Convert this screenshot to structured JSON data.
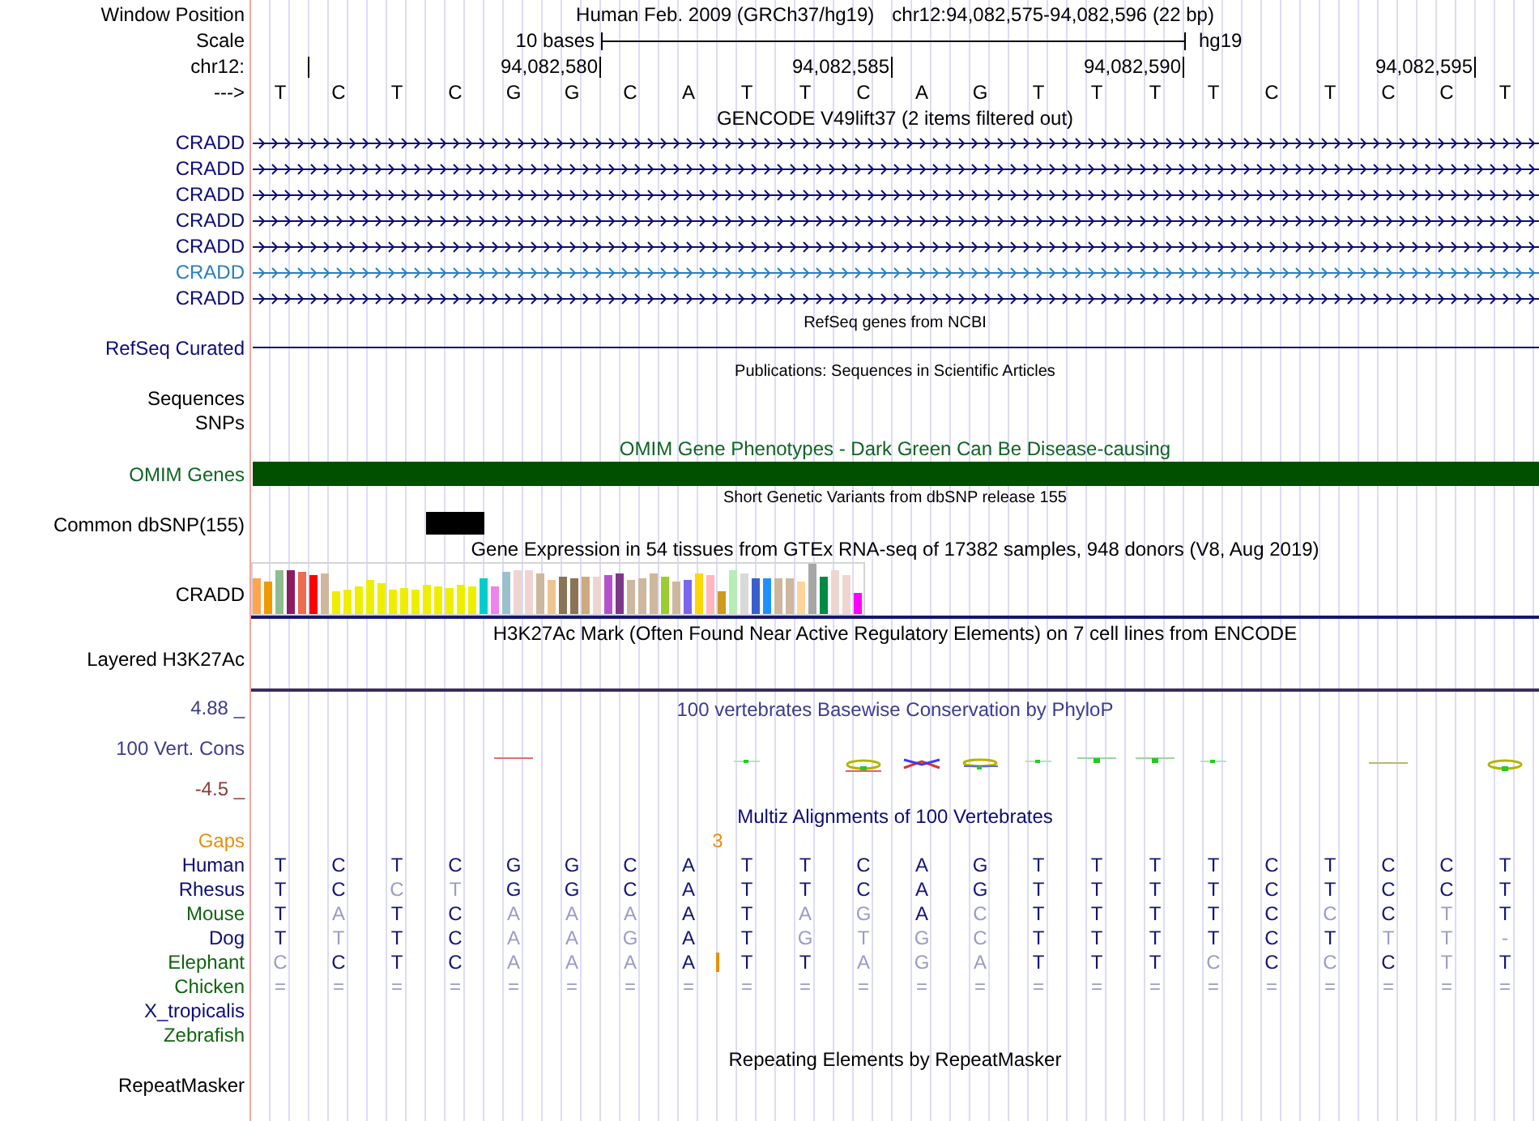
{
  "position": {
    "label": "Window Position",
    "assembly": "Human Feb. 2009 (GRCh37/hg19)",
    "range": "chr12:94,082,575-94,082,596 (22 bp)"
  },
  "scale": {
    "label": "Scale",
    "length": "10 bases",
    "assembly": "hg19"
  },
  "ruler": {
    "label": "chr12:",
    "ticks": [
      "94,082,580",
      "94,082,585",
      "94,082,590",
      "94,082,595"
    ]
  },
  "sequence": {
    "label": "--->",
    "bases": [
      {
        "base": "T",
        "common_snp": false
      },
      {
        "base": "C",
        "common_snp": false
      },
      {
        "base": "T",
        "common_snp": false
      },
      {
        "base": "C",
        "common_snp": true
      },
      {
        "base": "G",
        "common_snp": false
      },
      {
        "base": "G",
        "common_snp": false
      },
      {
        "base": "C",
        "common_snp": false
      },
      {
        "base": "A",
        "common_snp": false
      },
      {
        "base": "T",
        "common_snp": false
      },
      {
        "base": "T",
        "common_snp": false
      },
      {
        "base": "C",
        "common_snp": false
      },
      {
        "base": "A",
        "common_snp": false
      },
      {
        "base": "G",
        "common_snp": false
      },
      {
        "base": "T",
        "common_snp": false
      },
      {
        "base": "T",
        "common_snp": false
      },
      {
        "base": "T",
        "common_snp": false
      },
      {
        "base": "T",
        "common_snp": false
      },
      {
        "base": "C",
        "common_snp": false
      },
      {
        "base": "T",
        "common_snp": false
      },
      {
        "base": "C",
        "common_snp": false
      },
      {
        "base": "C",
        "common_snp": false
      },
      {
        "base": "T",
        "common_snp": false
      }
    ]
  },
  "gencode": {
    "title": "GENCODE V49lift37 (2 items filtered out)",
    "transcripts": [
      {
        "name": "CRADD",
        "color": "#0c0c78"
      },
      {
        "name": "CRADD",
        "color": "#0c0c78"
      },
      {
        "name": "CRADD",
        "color": "#0c0c78"
      },
      {
        "name": "CRADD",
        "color": "#0c0c78"
      },
      {
        "name": "CRADD",
        "color": "#0c0c78"
      },
      {
        "name": "CRADD",
        "color": "#2a7ec0"
      },
      {
        "name": "CRADD",
        "color": "#0c0c78"
      }
    ]
  },
  "refseq": {
    "title": "RefSeq genes from NCBI",
    "label": "RefSeq Curated"
  },
  "publications": {
    "title": "Publications: Sequences in Scientific Articles",
    "subtracks": [
      "Sequences",
      "SNPs"
    ]
  },
  "omim": {
    "title": "OMIM Gene Phenotypes - Dark Green Can Be Disease-causing",
    "label": "OMIM Genes"
  },
  "dbsnp": {
    "title": "Short Genetic Variants from dbSNP release 155",
    "label": "Common dbSNP(155)"
  },
  "gtex": {
    "title": "Gene Expression in 54 tissues from GTEx RNA-seq of 17382 samples, 948 donors (V8, Aug 2019)",
    "label": "CRADD"
  },
  "h3k27ac": {
    "title": "H3K27Ac Mark (Often Found Near Active Regulatory Elements) on 7 cell lines from ENCODE",
    "label": "Layered H3K27Ac"
  },
  "conservation": {
    "title": "100 vertebrates Basewise Conservation by PhyloP",
    "axis_max": "4.88 _",
    "label": "100 Vert. Cons",
    "axis_min": "-4.5 _"
  },
  "multiz": {
    "title": "Multiz Alignments of 100 Vertebrates",
    "gaps": {
      "label": "Gaps",
      "count": "3"
    },
    "species": [
      {
        "name": "Human",
        "color": "#0c0c78",
        "bases": [
          {
            "base": "T",
            "match": true
          },
          {
            "base": "C",
            "match": true
          },
          {
            "base": "T",
            "match": true
          },
          {
            "base": "C",
            "match": true
          },
          {
            "base": "G",
            "match": true
          },
          {
            "base": "G",
            "match": true
          },
          {
            "base": "C",
            "match": true
          },
          {
            "base": "A",
            "match": true
          },
          {
            "base": "T",
            "match": true
          },
          {
            "base": "T",
            "match": true
          },
          {
            "base": "C",
            "match": true
          },
          {
            "base": "A",
            "match": true
          },
          {
            "base": "G",
            "match": true
          },
          {
            "base": "T",
            "match": true
          },
          {
            "base": "T",
            "match": true
          },
          {
            "base": "T",
            "match": true
          },
          {
            "base": "T",
            "match": true
          },
          {
            "base": "C",
            "match": true
          },
          {
            "base": "T",
            "match": true
          },
          {
            "base": "C",
            "match": true
          },
          {
            "base": "C",
            "match": true
          },
          {
            "base": "T",
            "match": true
          }
        ]
      },
      {
        "name": "Rhesus",
        "color": "#0c0c78",
        "bases": [
          {
            "base": "T",
            "match": true
          },
          {
            "base": "C",
            "match": true
          },
          {
            "base": "C",
            "match": false
          },
          {
            "base": "T",
            "match": false
          },
          {
            "base": "G",
            "match": true
          },
          {
            "base": "G",
            "match": true
          },
          {
            "base": "C",
            "match": true
          },
          {
            "base": "A",
            "match": true
          },
          {
            "base": "T",
            "match": true
          },
          {
            "base": "T",
            "match": true
          },
          {
            "base": "C",
            "match": true
          },
          {
            "base": "A",
            "match": true
          },
          {
            "base": "G",
            "match": true
          },
          {
            "base": "T",
            "match": true
          },
          {
            "base": "T",
            "match": true
          },
          {
            "base": "T",
            "match": true
          },
          {
            "base": "T",
            "match": true
          },
          {
            "base": "C",
            "match": true
          },
          {
            "base": "T",
            "match": true
          },
          {
            "base": "C",
            "match": true
          },
          {
            "base": "C",
            "match": true
          },
          {
            "base": "T",
            "match": true
          }
        ]
      },
      {
        "name": "Mouse",
        "color": "#106410",
        "bases": [
          {
            "base": "T",
            "match": true
          },
          {
            "base": "A",
            "match": false
          },
          {
            "base": "T",
            "match": true
          },
          {
            "base": "C",
            "match": true
          },
          {
            "base": "A",
            "match": false
          },
          {
            "base": "A",
            "match": false
          },
          {
            "base": "A",
            "match": false
          },
          {
            "base": "A",
            "match": true
          },
          {
            "base": "T",
            "match": true
          },
          {
            "base": "A",
            "match": false
          },
          {
            "base": "G",
            "match": false
          },
          {
            "base": "A",
            "match": true
          },
          {
            "base": "C",
            "match": false
          },
          {
            "base": "T",
            "match": true
          },
          {
            "base": "T",
            "match": true
          },
          {
            "base": "T",
            "match": true
          },
          {
            "base": "T",
            "match": true
          },
          {
            "base": "C",
            "match": true
          },
          {
            "base": "C",
            "match": false
          },
          {
            "base": "C",
            "match": true
          },
          {
            "base": "T",
            "match": false
          },
          {
            "base": "T",
            "match": true
          }
        ]
      },
      {
        "name": "Dog",
        "color": "#0c0c78",
        "bases": [
          {
            "base": "T",
            "match": true
          },
          {
            "base": "T",
            "match": false
          },
          {
            "base": "T",
            "match": true
          },
          {
            "base": "C",
            "match": true
          },
          {
            "base": "A",
            "match": false
          },
          {
            "base": "A",
            "match": false
          },
          {
            "base": "G",
            "match": false
          },
          {
            "base": "A",
            "match": true
          },
          {
            "base": "T",
            "match": true
          },
          {
            "base": "G",
            "match": false
          },
          {
            "base": "T",
            "match": false
          },
          {
            "base": "G",
            "match": false
          },
          {
            "base": "C",
            "match": false
          },
          {
            "base": "T",
            "match": true
          },
          {
            "base": "T",
            "match": true
          },
          {
            "base": "T",
            "match": true
          },
          {
            "base": "T",
            "match": true
          },
          {
            "base": "C",
            "match": true
          },
          {
            "base": "T",
            "match": true
          },
          {
            "base": "T",
            "match": false
          },
          {
            "base": "T",
            "match": false
          },
          {
            "base": "-",
            "match": false
          }
        ]
      },
      {
        "name": "Elephant",
        "color": "#106410",
        "bases": [
          {
            "base": "C",
            "match": false,
            "insert": false
          },
          {
            "base": "C",
            "match": true,
            "insert": false
          },
          {
            "base": "T",
            "match": true,
            "insert": false
          },
          {
            "base": "C",
            "match": true,
            "insert": false
          },
          {
            "base": "A",
            "match": false,
            "insert": false
          },
          {
            "base": "A",
            "match": false,
            "insert": false
          },
          {
            "base": "A",
            "match": false,
            "insert": false
          },
          {
            "base": "A",
            "match": true,
            "insert": false
          },
          {
            "base": "T",
            "match": true,
            "insert": true
          },
          {
            "base": "T",
            "match": true,
            "insert": false
          },
          {
            "base": "A",
            "match": false,
            "insert": false
          },
          {
            "base": "G",
            "match": false,
            "insert": false
          },
          {
            "base": "A",
            "match": false,
            "insert": false
          },
          {
            "base": "T",
            "match": true,
            "insert": false
          },
          {
            "base": "T",
            "match": true,
            "insert": false
          },
          {
            "base": "T",
            "match": true,
            "insert": false
          },
          {
            "base": "C",
            "match": false,
            "insert": false
          },
          {
            "base": "C",
            "match": true,
            "insert": false
          },
          {
            "base": "C",
            "match": false,
            "insert": false
          },
          {
            "base": "C",
            "match": true,
            "insert": false
          },
          {
            "base": "T",
            "match": false,
            "insert": false
          },
          {
            "base": "T",
            "match": true,
            "insert": false
          }
        ]
      },
      {
        "name": "Chicken",
        "color": "#106410",
        "bases": [
          {
            "base": "=",
            "match": false
          },
          {
            "base": "=",
            "match": false
          },
          {
            "base": "=",
            "match": false
          },
          {
            "base": "=",
            "match": false
          },
          {
            "base": "=",
            "match": false
          },
          {
            "base": "=",
            "match": false
          },
          {
            "base": "=",
            "match": false
          },
          {
            "base": "=",
            "match": false
          },
          {
            "base": "=",
            "match": false
          },
          {
            "base": "=",
            "match": false
          },
          {
            "base": "=",
            "match": false
          },
          {
            "base": "=",
            "match": false
          },
          {
            "base": "=",
            "match": false
          },
          {
            "base": "=",
            "match": false
          },
          {
            "base": "=",
            "match": false
          },
          {
            "base": "=",
            "match": false
          },
          {
            "base": "=",
            "match": false
          },
          {
            "base": "=",
            "match": false
          },
          {
            "base": "=",
            "match": false
          },
          {
            "base": "=",
            "match": false
          },
          {
            "base": "=",
            "match": false
          },
          {
            "base": "=",
            "match": false
          }
        ]
      },
      {
        "name": "X_tropicalis",
        "color": "#0c0c78"
      },
      {
        "name": "Zebrafish",
        "color": "#106410"
      }
    ]
  },
  "repeatmasker": {
    "title": "Repeating Elements by RepeatMasker",
    "label": "RepeatMasker"
  }
}
